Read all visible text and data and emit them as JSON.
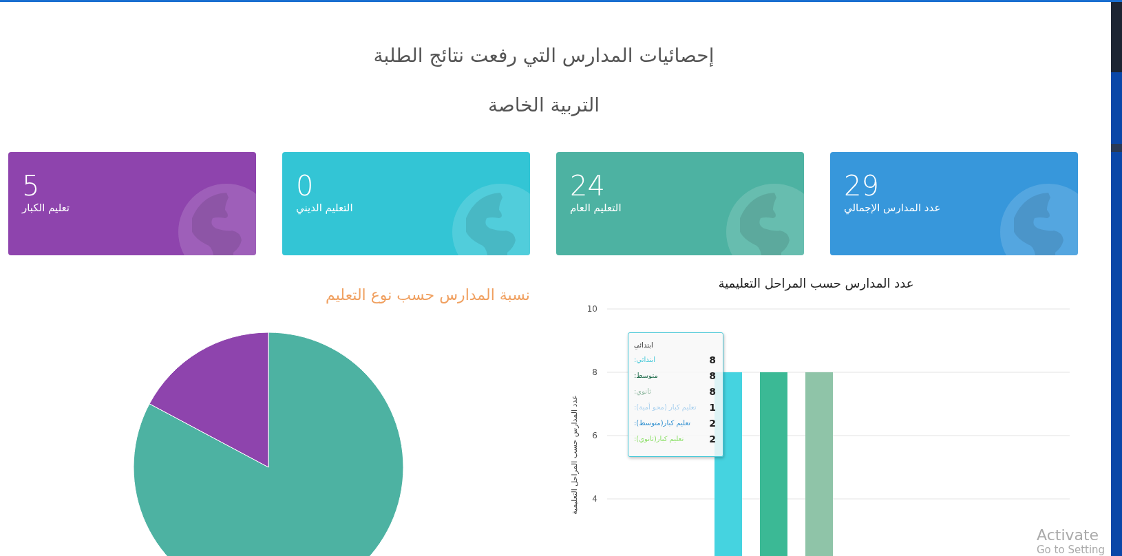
{
  "page": {
    "title": "إحصائيات المدارس التي رفعت نتائج الطلبة",
    "subtitle": "التربية الخاصة"
  },
  "stats": [
    {
      "value": "29",
      "label": "عدد المدارس الإجمالي",
      "color": "#3797db"
    },
    {
      "value": "24",
      "label": "التعليم العام",
      "color": "#4db2a2"
    },
    {
      "value": "0",
      "label": "التعليم الديني",
      "color": "#33c5d5"
    },
    {
      "value": "5",
      "label": "تعليم الكبار",
      "color": "#8e44ad"
    }
  ],
  "bar_chart": {
    "chart_data": {
      "type": "bar",
      "title": "عدد المدارس حسب المراحل التعليمية",
      "ylabel": "عدد المدارس حسب المراحل التعليمية",
      "yticks": [
        4,
        6,
        8,
        10
      ],
      "ylim": [
        0,
        10
      ],
      "grid": true,
      "series": [
        {
          "color": "#45d3e0",
          "values": [
            8
          ]
        },
        {
          "color": "#3bb995",
          "values": [
            8
          ]
        },
        {
          "color": "#8fc4a8",
          "values": [
            8
          ]
        }
      ]
    },
    "tooltip": {
      "title": "ابتدائي",
      "rows": [
        {
          "label": "ابتدائي:",
          "value": "8",
          "color": "#45c8d8"
        },
        {
          "label": "متوسط:",
          "value": "8",
          "color": "#1e6b4a"
        },
        {
          "label": "ثانوي:",
          "value": "8",
          "color": "#8fb8a0"
        },
        {
          "label": "تعليم كبار (محو أمية):",
          "value": "1",
          "color": "#a6cfee"
        },
        {
          "label": "تعليم كبار(متوسط):",
          "value": "2",
          "color": "#2f8fd0"
        },
        {
          "label": "تعليم كبار(ثانوي):",
          "value": "2",
          "color": "#8ee06a"
        }
      ]
    }
  },
  "pie_chart": {
    "chart_data": {
      "type": "pie",
      "title": "نسبة المدارس حسب نوع التعليم",
      "values": [
        82.8,
        17.2
      ],
      "colors": [
        "#4db2a2",
        "#8e44ad"
      ]
    }
  },
  "os_notice": {
    "title": "Activate",
    "subtitle": "Go to Setting"
  }
}
